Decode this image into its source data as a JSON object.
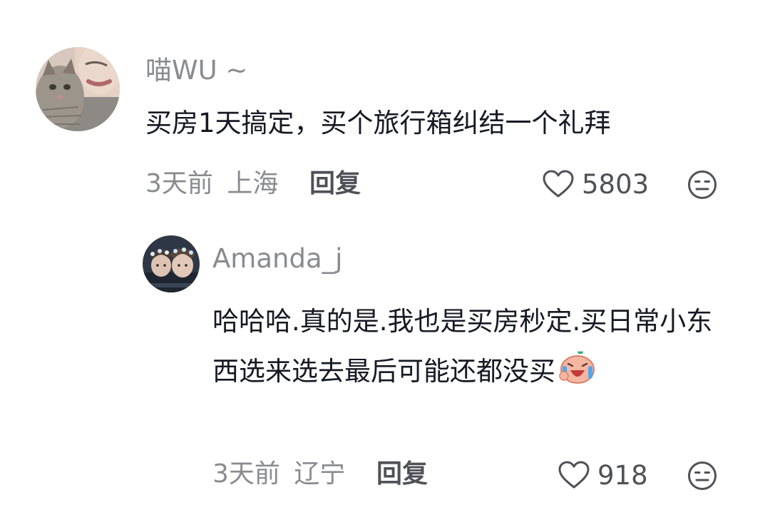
{
  "comments": [
    {
      "username": "喵WU ~",
      "text": "买房1天搞定，买个旅行箱纠结一个礼拜",
      "time": "3天前",
      "location": "上海",
      "reply_label": "回复",
      "likes": "5803"
    }
  ],
  "replies": [
    {
      "username": "Amanda_j",
      "text": "哈哈哈.真的是.我也是买房秒定.买日常小东西选来选去最后可能还都没买",
      "time": "3天前",
      "location": "辽宁",
      "reply_label": "回复",
      "likes": "918"
    }
  ],
  "icons": {
    "like": "heart-outline-icon",
    "dislike": "unhappy-face-icon",
    "reaction_emoji": "laugh-cry-emoji"
  },
  "colors": {
    "username": "#8a8b91",
    "body_text": "#161823",
    "meta": "#8a8b91",
    "reply_button": "#505158"
  }
}
